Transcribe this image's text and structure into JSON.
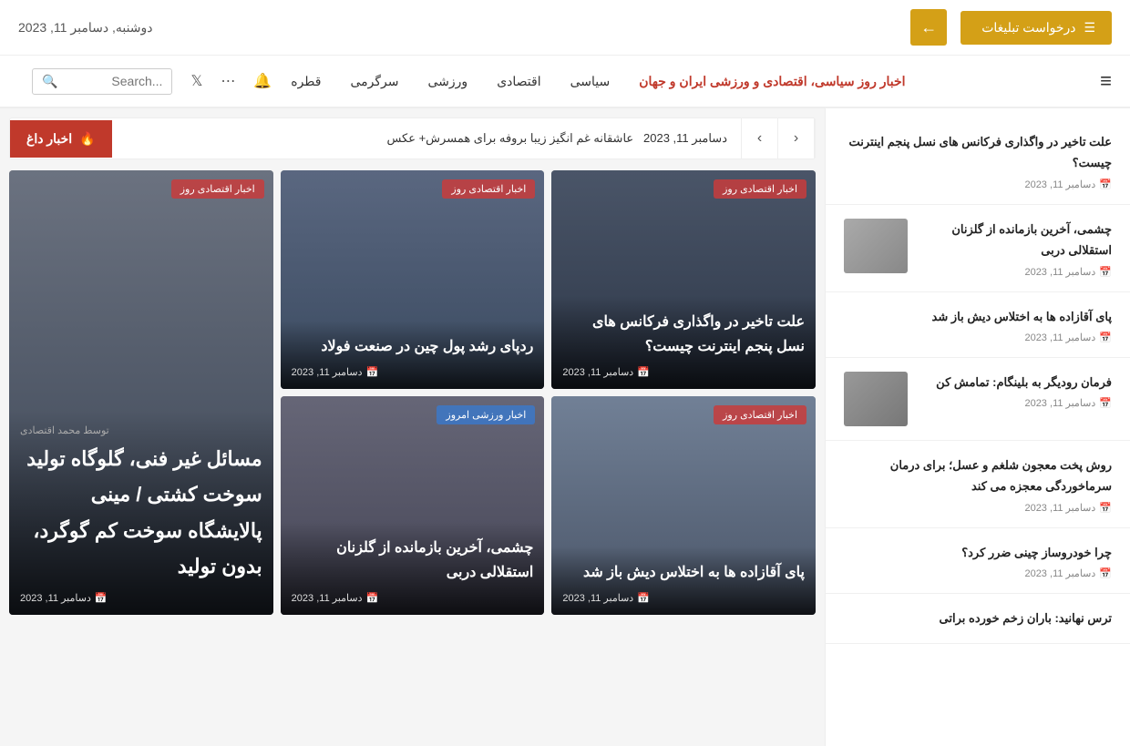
{
  "header": {
    "ad_button": "درخواست تبلیغات",
    "ad_icon": "☰",
    "arrow_icon": "←",
    "date": "دوشنبه, دسامبر 11, 2023"
  },
  "nav": {
    "search_placeholder": "...Search",
    "links": [
      {
        "label": "قطره"
      },
      {
        "label": "سرگرمی"
      },
      {
        "label": "ورزشی"
      },
      {
        "label": "اقتصادی"
      },
      {
        "label": "سیاسی"
      },
      {
        "label": "اخبار روز سیاسی، اقتصادی و ورزشی ایران و جهان",
        "brand": true
      }
    ]
  },
  "breaking": {
    "label": "اخبار داغ",
    "label_icon": "🔥",
    "text": "عاشقانه غم انگیز زیبا بروفه  برای همسرش+ عکس",
    "date": "دسامبر 11, 2023"
  },
  "sidebar": {
    "articles": [
      {
        "title": "علت تاخیر در واگذاری فرکانس های نسل پنجم اینترنت چیست؟",
        "date": "دسامبر 11, 2023"
      },
      {
        "title": "چشمی، آخرین بازمانده از گلزنان استقلالی دربی",
        "date": "دسامبر 11, 2023",
        "has_thumb": true
      },
      {
        "title": "پای آقازاده ها به اختلاس دیش باز شد",
        "date": "دسامبر 11, 2023"
      },
      {
        "title": "فرمان رودیگر به بلینگام: تمامش کن",
        "date": "دسامبر 11, 2023",
        "has_thumb": true
      },
      {
        "title": "روش پخت معجون شلغم و عسل؛ برای درمان سرماخوردگی معجزه می کند",
        "date": "دسامبر 11, 2023"
      },
      {
        "title": "چرا خودروساز چینی ضرر کرد؟",
        "date": "دسامبر 11, 2023"
      },
      {
        "title": "ترس نهانید: باران زخم خورده براتی",
        "date": ""
      }
    ]
  },
  "news_grid": {
    "cards": [
      {
        "id": "card1",
        "category": "اخبار اقتصادی روز",
        "category_type": "economic",
        "title": "علت تاخیر در واگذاری فرکانس های نسل پنجم اینترنت چیست؟",
        "date": "دسامبر 11, 2023",
        "size": "normal",
        "bg": "dark"
      },
      {
        "id": "card2",
        "category": "اخبار اقتصادی روز",
        "category_type": "economic",
        "title": "ردپای رشد پول چین در صنعت فولاد",
        "date": "دسامبر 11, 2023",
        "size": "normal",
        "bg": "medium"
      },
      {
        "id": "card3",
        "category": "اخبار اقتصادی روز",
        "category_type": "economic",
        "title": "مسائل غیر فنی، گلوگاه تولید سوخت کشتی / مینی پالایشگاه سوخت کم گوگرد، بدون تولید",
        "date": "دسامبر 11, 2023",
        "author": "توسط محمد اقتصادی",
        "size": "large",
        "bg": "gray2"
      },
      {
        "id": "card4",
        "category": "اخبار اقتصادی روز",
        "category_type": "economic",
        "title": "پای آقازاده ها به اختلاس دیش باز شد",
        "date": "دسامبر 11, 2023",
        "size": "normal",
        "bg": "light-gray"
      },
      {
        "id": "card5",
        "category": "اخبار ورزشی امروز",
        "category_type": "sports",
        "title": "چشمی، آخرین بازمانده از گلزنان استقلالی دربی",
        "date": "دسامبر 11, 2023",
        "size": "normal",
        "bg": "medium"
      }
    ]
  },
  "icons": {
    "calendar": "📅",
    "fire": "🔥",
    "arrow_left": "‹",
    "arrow_right": "›",
    "search": "🔍",
    "twitter": "𝕏",
    "share": "⋯",
    "bell": "🔔",
    "menu": "≡"
  }
}
